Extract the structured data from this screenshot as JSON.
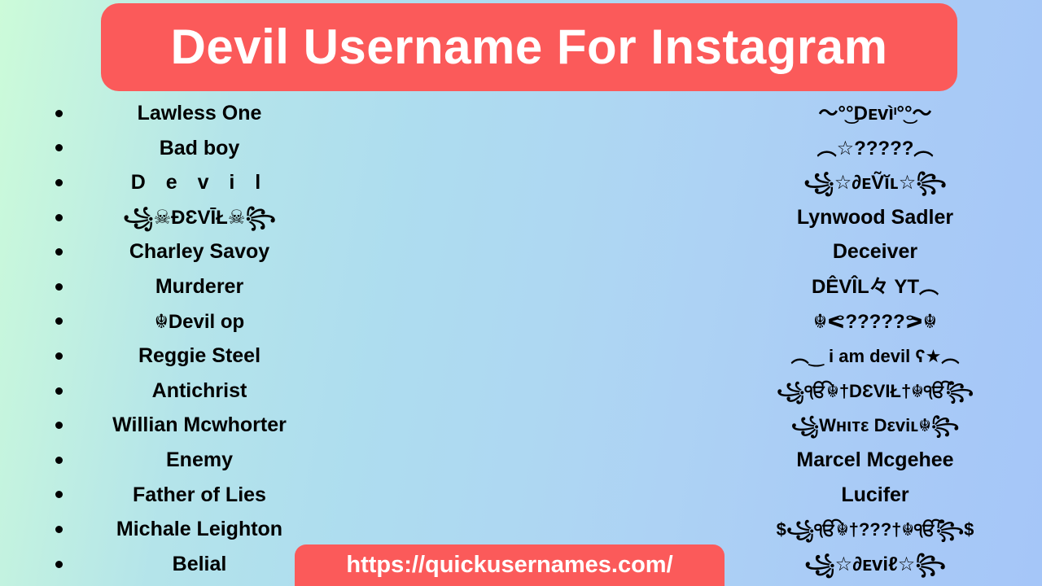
{
  "header": {
    "title": "Devil Username For Instagram",
    "banner_color": "#fb5a5a",
    "title_color": "#ffffff"
  },
  "background": {
    "gradient_from": "#ccfbd9",
    "gradient_mid": "#aeddef",
    "gradient_to": "#a5c6f8"
  },
  "list": {
    "bullet_color": "#000000",
    "text_color": "#000000",
    "left_column": [
      {
        "text": "Lawless One",
        "style": "plain"
      },
      {
        "text": "Bad boy",
        "style": "plain"
      },
      {
        "text": "D e v i l",
        "style": "spaced"
      },
      {
        "text": "꧁☠ÐƐVĪŁ☠꧂",
        "style": "fancy"
      },
      {
        "text": "Charley Savoy",
        "style": "plain"
      },
      {
        "text": "Murderer",
        "style": "plain"
      },
      {
        "text": "☬Devil op",
        "style": "fancy"
      },
      {
        "text": "Reggie Steel",
        "style": "plain"
      },
      {
        "text": "Antichrist",
        "style": "plain"
      },
      {
        "text": "Willian Mcwhorter",
        "style": "plain"
      },
      {
        "text": "Enemy",
        "style": "plain"
      },
      {
        "text": "Father of Lies",
        "style": "plain"
      },
      {
        "text": "Michale Leighton",
        "style": "plain"
      },
      {
        "text": "Belial",
        "style": "plain"
      }
    ],
    "right_column": [
      {
        "text": "〜°͜°Dᴇvìᶦ°͜°〜",
        "style": "fancy"
      },
      {
        "text": "︵☆?????︵",
        "style": "fancy"
      },
      {
        "text": "꧁☆∂ᴇṼĭʟ☆꧂",
        "style": "fancy"
      },
      {
        "text": "Lynwood Sadler",
        "style": "plain"
      },
      {
        "text": "Deceiver",
        "style": "plain"
      },
      {
        "text": "DÊVÎL々 YT︵",
        "style": "fancy"
      },
      {
        "text": "☬ᕙ?????ᕗ☬",
        "style": "fancy"
      },
      {
        "text": "︵‿ i am devil ʕ★︵",
        "style": "fancy-sm"
      },
      {
        "text": "꧁ੴ☬†DƐVIŁ†☬ੴ꧂",
        "style": "fancy-sm"
      },
      {
        "text": "꧁Wнιтε Dεviʟ☬꧂",
        "style": "fancy-sm"
      },
      {
        "text": "Marcel Mcgehee",
        "style": "plain"
      },
      {
        "text": "Lucifer",
        "style": "plain"
      },
      {
        "text": "$꧁ੴ☬†???†☬ੴ꧂$",
        "style": "fancy-sm"
      },
      {
        "text": "꧁☆∂ᴇviℓ☆꧂",
        "style": "fancy"
      }
    ]
  },
  "footer": {
    "url": "https://quickusernames.com/",
    "banner_color": "#fb5a5a",
    "url_color": "#ffffff"
  }
}
